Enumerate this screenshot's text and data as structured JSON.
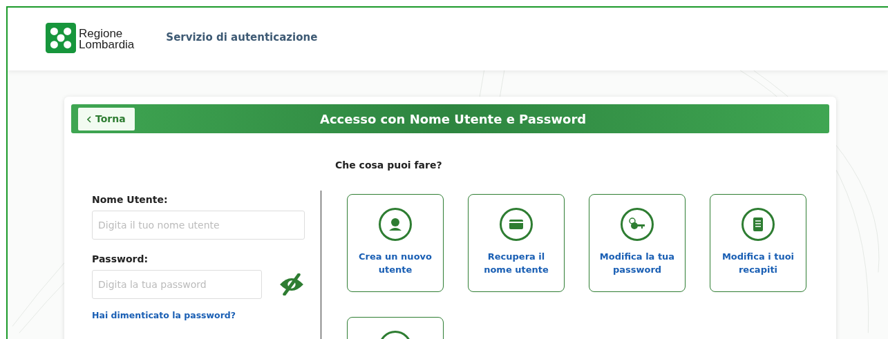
{
  "header": {
    "logo_line1": "Regione",
    "logo_line2": "Lombardia",
    "service_title": "Servizio di autenticazione"
  },
  "panel": {
    "back_button": "Torna",
    "title": "Accesso con Nome Utente e Password"
  },
  "login": {
    "username_label": "Nome Utente:",
    "username_placeholder": "Digita il tuo nome utente",
    "password_label": "Password:",
    "password_placeholder": "Digita la tua password",
    "forgot_link": "Hai dimenticato la password?"
  },
  "actions": {
    "heading": "Che cosa puoi fare?",
    "tiles": [
      {
        "kind": "user",
        "label": "Crea un nuovo utente"
      },
      {
        "kind": "card",
        "label": "Recupera il nome utente"
      },
      {
        "kind": "keys",
        "label": "Modifica la tua password"
      },
      {
        "kind": "list",
        "label": "Modifica i tuoi recapiti"
      },
      {
        "kind": "other"
      }
    ]
  }
}
